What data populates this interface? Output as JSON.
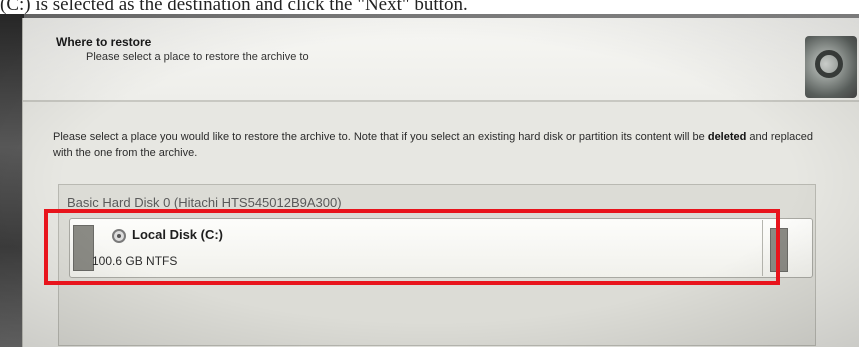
{
  "caption": "(C:) is selected as the destination and click the \"Next\" button.",
  "dialog": {
    "header": {
      "title": "Where to restore",
      "subtitle": "Please select a place to restore the archive to"
    },
    "instructions": {
      "part1": "Please select a place you would like to restore the archive to. Note that if you select an existing hard disk or partition its content will be ",
      "emphasis": "deleted",
      "part2": " and replaced with the one from the archive."
    },
    "disk": {
      "title": "Basic Hard Disk 0 (Hitachi HTS545012B9A300)",
      "partition": {
        "name": "Local Disk (C:)",
        "info": "100.6 GB NTFS"
      }
    }
  },
  "colors": {
    "highlight": "#e8141c",
    "dialog_bg": "#e7e7e2"
  },
  "icons": {
    "drive": "drive-icon",
    "header": "restore-graphic-icon"
  }
}
